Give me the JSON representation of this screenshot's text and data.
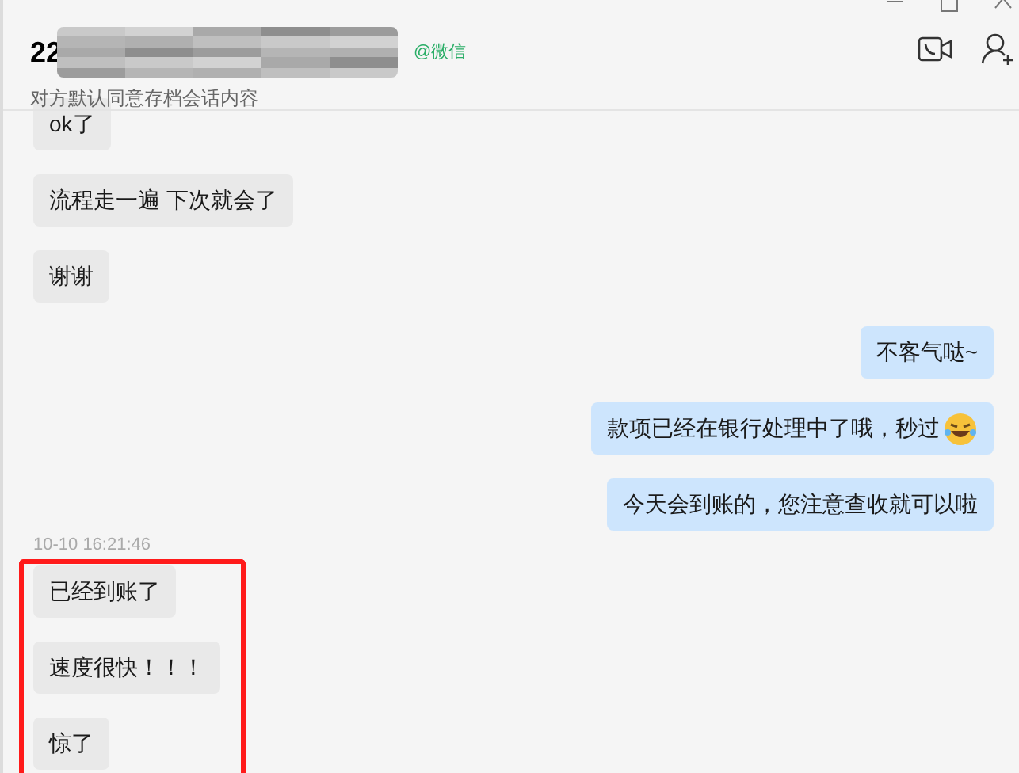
{
  "header": {
    "title": "22",
    "source": "@微信",
    "subtitle": "对方默认同意存档会话内容"
  },
  "messages": [
    {
      "kind": "received",
      "text": "ok了"
    },
    {
      "kind": "received",
      "text": "流程走一遍 下次就会了"
    },
    {
      "kind": "received",
      "text": "谢谢"
    },
    {
      "kind": "sent",
      "text": "不客气哒~"
    },
    {
      "kind": "sent",
      "text": "款项已经在银行处理中了哦，秒过",
      "emoji": true
    },
    {
      "kind": "sent",
      "text": "今天会到账的，您注意查收就可以啦"
    }
  ],
  "timestamp": "10-10 16:21:46",
  "highlighted_messages": [
    {
      "kind": "received",
      "text": "已经到账了"
    },
    {
      "kind": "received",
      "text": "速度很快！！！"
    },
    {
      "kind": "received",
      "text": "惊了"
    }
  ]
}
